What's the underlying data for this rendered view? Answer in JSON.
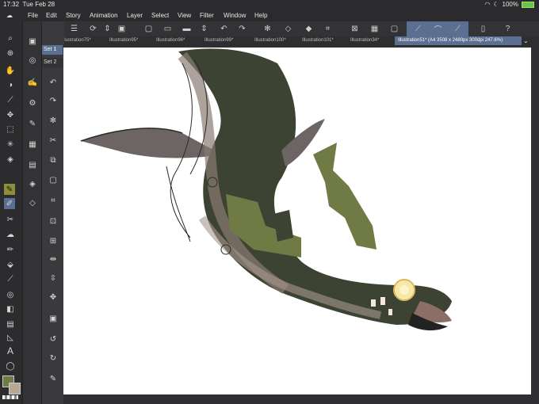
{
  "status": {
    "time": "17:32",
    "date": "Tue Feb 28",
    "battery": "100%"
  },
  "menu": [
    "File",
    "Edit",
    "Story",
    "Animation",
    "Layer",
    "Select",
    "View",
    "Filter",
    "Window",
    "Help"
  ],
  "tabs": [
    {
      "label": "llustration75*",
      "active": false
    },
    {
      "label": "Illustration95*",
      "active": false
    },
    {
      "label": "Illustration96*",
      "active": false
    },
    {
      "label": "Illustration99*",
      "active": false
    },
    {
      "label": "Illustration100*",
      "active": false
    },
    {
      "label": "Illustration101*",
      "active": false
    },
    {
      "label": "Illustration34*",
      "active": false
    },
    {
      "label": "Illustration51* (A4 3508 x 2480px 300dpi 247.6%)",
      "active": true
    }
  ],
  "sets": [
    "Set 1",
    "Set 2"
  ],
  "colors": {
    "main": "#6f7a45",
    "sub": "#b9a893",
    "accent_blue": "#5b6f90"
  }
}
